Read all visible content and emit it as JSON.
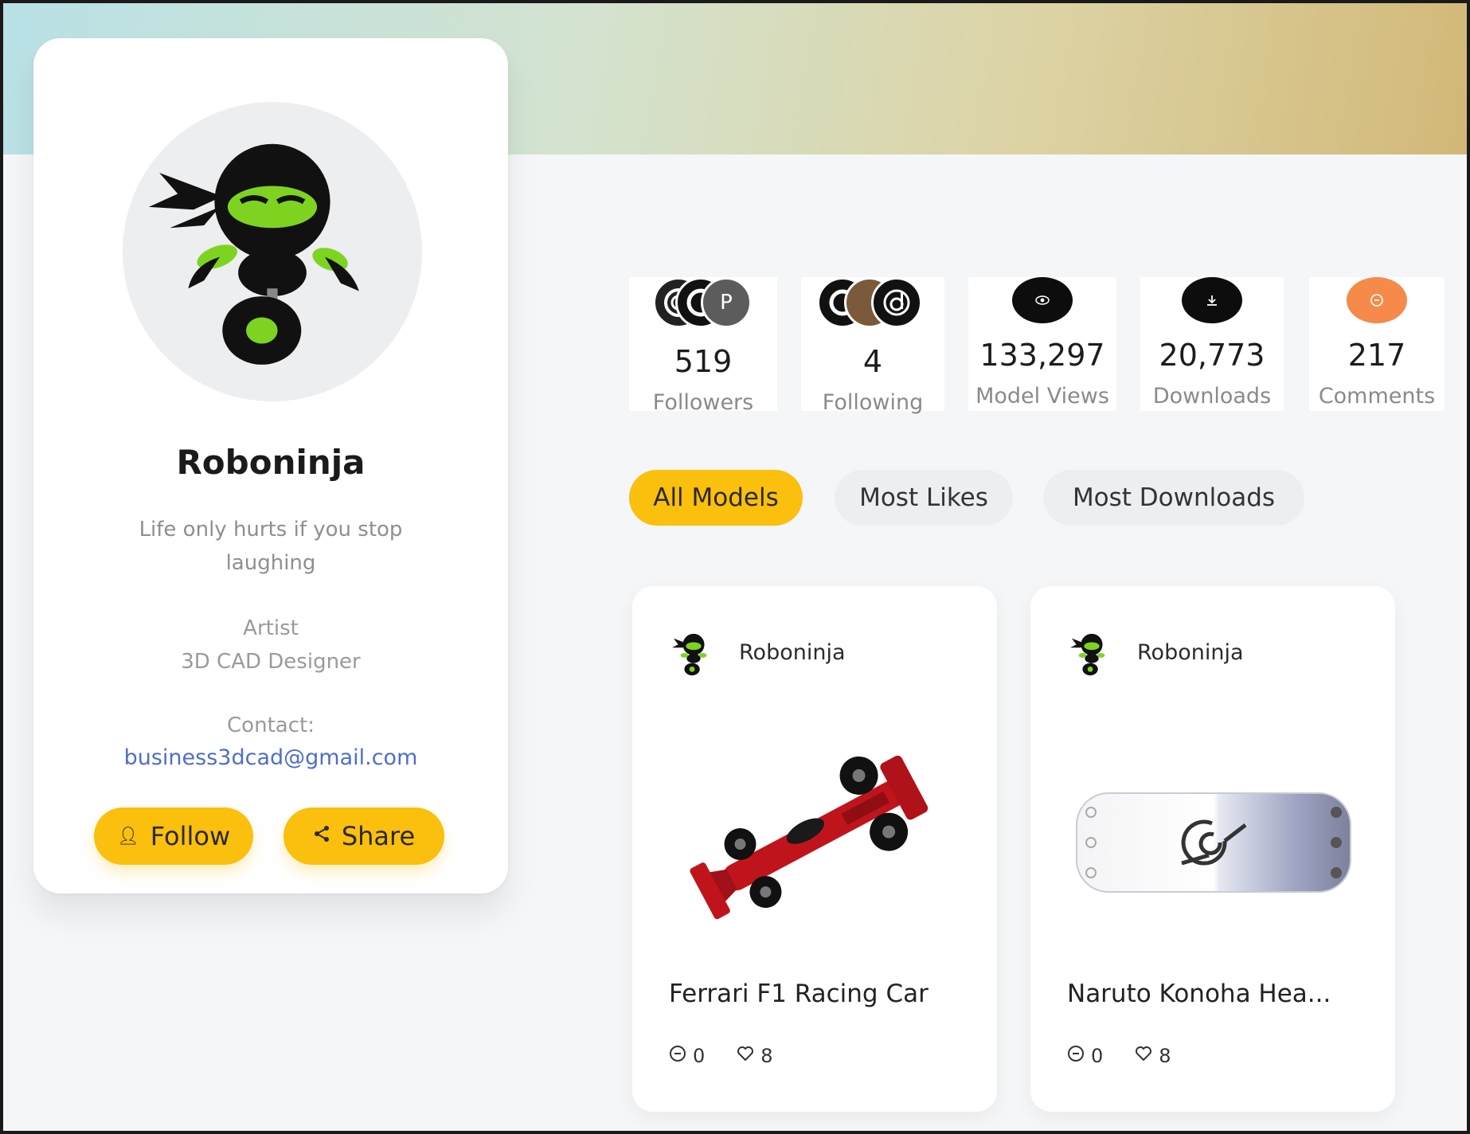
{
  "profile": {
    "name": "Roboninja",
    "bio": "Life only hurts if you stop laughing",
    "role_label": "Artist",
    "role_value": "3D CAD Designer",
    "contact_label": "Contact:",
    "email": "business3dcad@gmail.com",
    "follow_label": "Follow",
    "share_label": "Share"
  },
  "stats": {
    "followers": {
      "value": "519",
      "label": "Followers",
      "avatar_letter": "P"
    },
    "following": {
      "value": "4",
      "label": "Following"
    },
    "views": {
      "value": "133,297",
      "label": "Model Views",
      "icon": "eye-icon"
    },
    "downloads": {
      "value": "20,773",
      "label": "Downloads",
      "icon": "download-icon"
    },
    "comments": {
      "value": "217",
      "label": "Comments",
      "icon": "comment-icon"
    }
  },
  "tabs": [
    {
      "label": "All Models",
      "active": true
    },
    {
      "label": "Most Likes",
      "active": false
    },
    {
      "label": "Most Downloads",
      "active": false
    }
  ],
  "models": [
    {
      "author": "Roboninja",
      "title": "Ferrari F1 Racing Car",
      "comments": "0",
      "likes": "8"
    },
    {
      "author": "Roboninja",
      "title": "Naruto Konoha Hea...",
      "comments": "0",
      "likes": "8"
    }
  ],
  "colors": {
    "accent": "#fbbf0d",
    "comment_icon_bg": "#f58a4a",
    "email": "#4f6fc6"
  }
}
